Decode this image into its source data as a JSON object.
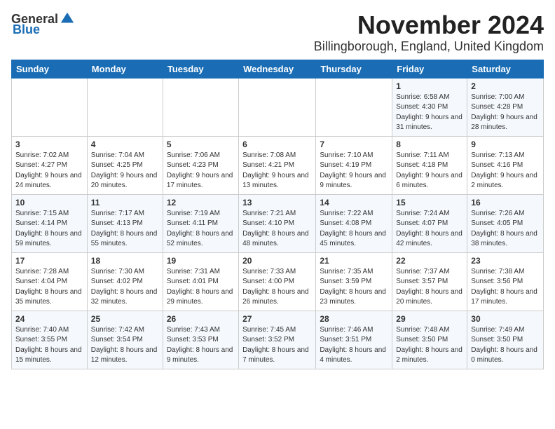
{
  "logo": {
    "general": "General",
    "blue": "Blue"
  },
  "title": "November 2024",
  "location": "Billingborough, England, United Kingdom",
  "days_of_week": [
    "Sunday",
    "Monday",
    "Tuesday",
    "Wednesday",
    "Thursday",
    "Friday",
    "Saturday"
  ],
  "weeks": [
    [
      {
        "day": "",
        "info": ""
      },
      {
        "day": "",
        "info": ""
      },
      {
        "day": "",
        "info": ""
      },
      {
        "day": "",
        "info": ""
      },
      {
        "day": "",
        "info": ""
      },
      {
        "day": "1",
        "info": "Sunrise: 6:58 AM\nSunset: 4:30 PM\nDaylight: 9 hours and 31 minutes."
      },
      {
        "day": "2",
        "info": "Sunrise: 7:00 AM\nSunset: 4:28 PM\nDaylight: 9 hours and 28 minutes."
      }
    ],
    [
      {
        "day": "3",
        "info": "Sunrise: 7:02 AM\nSunset: 4:27 PM\nDaylight: 9 hours and 24 minutes."
      },
      {
        "day": "4",
        "info": "Sunrise: 7:04 AM\nSunset: 4:25 PM\nDaylight: 9 hours and 20 minutes."
      },
      {
        "day": "5",
        "info": "Sunrise: 7:06 AM\nSunset: 4:23 PM\nDaylight: 9 hours and 17 minutes."
      },
      {
        "day": "6",
        "info": "Sunrise: 7:08 AM\nSunset: 4:21 PM\nDaylight: 9 hours and 13 minutes."
      },
      {
        "day": "7",
        "info": "Sunrise: 7:10 AM\nSunset: 4:19 PM\nDaylight: 9 hours and 9 minutes."
      },
      {
        "day": "8",
        "info": "Sunrise: 7:11 AM\nSunset: 4:18 PM\nDaylight: 9 hours and 6 minutes."
      },
      {
        "day": "9",
        "info": "Sunrise: 7:13 AM\nSunset: 4:16 PM\nDaylight: 9 hours and 2 minutes."
      }
    ],
    [
      {
        "day": "10",
        "info": "Sunrise: 7:15 AM\nSunset: 4:14 PM\nDaylight: 8 hours and 59 minutes."
      },
      {
        "day": "11",
        "info": "Sunrise: 7:17 AM\nSunset: 4:13 PM\nDaylight: 8 hours and 55 minutes."
      },
      {
        "day": "12",
        "info": "Sunrise: 7:19 AM\nSunset: 4:11 PM\nDaylight: 8 hours and 52 minutes."
      },
      {
        "day": "13",
        "info": "Sunrise: 7:21 AM\nSunset: 4:10 PM\nDaylight: 8 hours and 48 minutes."
      },
      {
        "day": "14",
        "info": "Sunrise: 7:22 AM\nSunset: 4:08 PM\nDaylight: 8 hours and 45 minutes."
      },
      {
        "day": "15",
        "info": "Sunrise: 7:24 AM\nSunset: 4:07 PM\nDaylight: 8 hours and 42 minutes."
      },
      {
        "day": "16",
        "info": "Sunrise: 7:26 AM\nSunset: 4:05 PM\nDaylight: 8 hours and 38 minutes."
      }
    ],
    [
      {
        "day": "17",
        "info": "Sunrise: 7:28 AM\nSunset: 4:04 PM\nDaylight: 8 hours and 35 minutes."
      },
      {
        "day": "18",
        "info": "Sunrise: 7:30 AM\nSunset: 4:02 PM\nDaylight: 8 hours and 32 minutes."
      },
      {
        "day": "19",
        "info": "Sunrise: 7:31 AM\nSunset: 4:01 PM\nDaylight: 8 hours and 29 minutes."
      },
      {
        "day": "20",
        "info": "Sunrise: 7:33 AM\nSunset: 4:00 PM\nDaylight: 8 hours and 26 minutes."
      },
      {
        "day": "21",
        "info": "Sunrise: 7:35 AM\nSunset: 3:59 PM\nDaylight: 8 hours and 23 minutes."
      },
      {
        "day": "22",
        "info": "Sunrise: 7:37 AM\nSunset: 3:57 PM\nDaylight: 8 hours and 20 minutes."
      },
      {
        "day": "23",
        "info": "Sunrise: 7:38 AM\nSunset: 3:56 PM\nDaylight: 8 hours and 17 minutes."
      }
    ],
    [
      {
        "day": "24",
        "info": "Sunrise: 7:40 AM\nSunset: 3:55 PM\nDaylight: 8 hours and 15 minutes."
      },
      {
        "day": "25",
        "info": "Sunrise: 7:42 AM\nSunset: 3:54 PM\nDaylight: 8 hours and 12 minutes."
      },
      {
        "day": "26",
        "info": "Sunrise: 7:43 AM\nSunset: 3:53 PM\nDaylight: 8 hours and 9 minutes."
      },
      {
        "day": "27",
        "info": "Sunrise: 7:45 AM\nSunset: 3:52 PM\nDaylight: 8 hours and 7 minutes."
      },
      {
        "day": "28",
        "info": "Sunrise: 7:46 AM\nSunset: 3:51 PM\nDaylight: 8 hours and 4 minutes."
      },
      {
        "day": "29",
        "info": "Sunrise: 7:48 AM\nSunset: 3:50 PM\nDaylight: 8 hours and 2 minutes."
      },
      {
        "day": "30",
        "info": "Sunrise: 7:49 AM\nSunset: 3:50 PM\nDaylight: 8 hours and 0 minutes."
      }
    ]
  ]
}
